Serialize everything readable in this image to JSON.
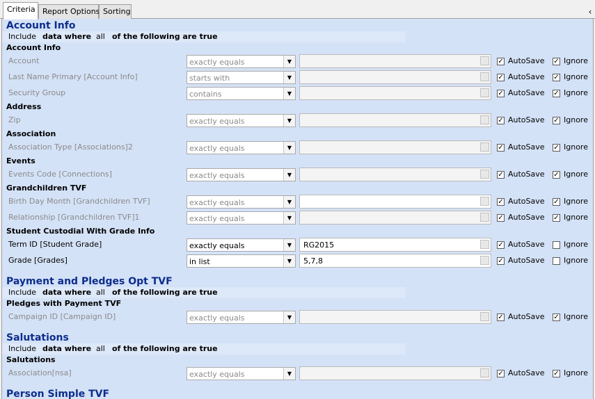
{
  "tabs": [
    {
      "label": "Criteria",
      "active": true
    },
    {
      "label": "Report Options",
      "active": false
    },
    {
      "label": "Sorting",
      "active": false
    }
  ],
  "collapse_glyph": "‹",
  "autosave_label": "AutoSave",
  "ignore_label": "Ignore",
  "sections": [
    {
      "title": "Account Info",
      "include": {
        "include": "Include",
        "data_where": "data where",
        "all": "all",
        "following": "of the following are true"
      },
      "groups": [
        {
          "name": "Account Info",
          "rows": [
            {
              "label": "Account",
              "operator": "exactly equals",
              "value": "",
              "autosave": true,
              "ignore": true
            },
            {
              "label": "Last Name Primary [Account Info]",
              "operator": "starts with",
              "value": "",
              "autosave": true,
              "ignore": true
            },
            {
              "label": "Security Group",
              "operator": "contains",
              "value": "",
              "autosave": true,
              "ignore": true
            }
          ]
        },
        {
          "name": "Address",
          "rows": [
            {
              "label": "Zip",
              "operator": "exactly equals",
              "value": "",
              "autosave": true,
              "ignore": true
            }
          ]
        },
        {
          "name": "Association",
          "rows": [
            {
              "label": "Association Type [Associations]2",
              "operator": "exactly equals",
              "value": "",
              "autosave": true,
              "ignore": true
            }
          ]
        },
        {
          "name": "Events",
          "rows": [
            {
              "label": "Events Code [Connections]",
              "operator": "exactly equals",
              "value": "",
              "autosave": true,
              "ignore": true
            }
          ]
        },
        {
          "name": "Grandchildren TVF",
          "rows": [
            {
              "label": "Birth Day Month [Grandchildren TVF]",
              "operator": "exactly equals",
              "value": "",
              "autosave": true,
              "ignore": true,
              "white": true
            },
            {
              "label": "Relationship [Grandchildren TVF]1",
              "operator": "exactly equals",
              "value": "",
              "autosave": true,
              "ignore": true
            }
          ]
        },
        {
          "name": "Student Custodial With Grade Info",
          "rows": [
            {
              "label": "Term ID [Student Grade]",
              "operator": "exactly equals",
              "value": "RG2015",
              "autosave": true,
              "ignore": false,
              "active": true
            },
            {
              "label": "Grade  [Grades]",
              "operator": "in list",
              "value": "5,7,8",
              "autosave": true,
              "ignore": false,
              "active": true
            }
          ]
        }
      ]
    },
    {
      "title": "Payment and Pledges Opt TVF",
      "include": {
        "include": "Include",
        "data_where": "data where",
        "all": "all",
        "following": "of the following are true"
      },
      "groups": [
        {
          "name": "Pledges with Payment TVF",
          "rows": [
            {
              "label": "Campaign ID [Campaign ID]",
              "operator": "exactly equals",
              "value": "",
              "autosave": true,
              "ignore": true
            }
          ]
        }
      ]
    },
    {
      "title": "Salutations",
      "include": {
        "include": "Include",
        "data_where": "data where",
        "all": "all",
        "following": "of the following are true"
      },
      "groups": [
        {
          "name": "Salutations",
          "rows": [
            {
              "label": "Association[nsa]",
              "operator": "exactly equals",
              "value": "",
              "autosave": true,
              "ignore": true
            }
          ]
        }
      ]
    },
    {
      "title": "Person Simple TVF",
      "groups": []
    }
  ]
}
